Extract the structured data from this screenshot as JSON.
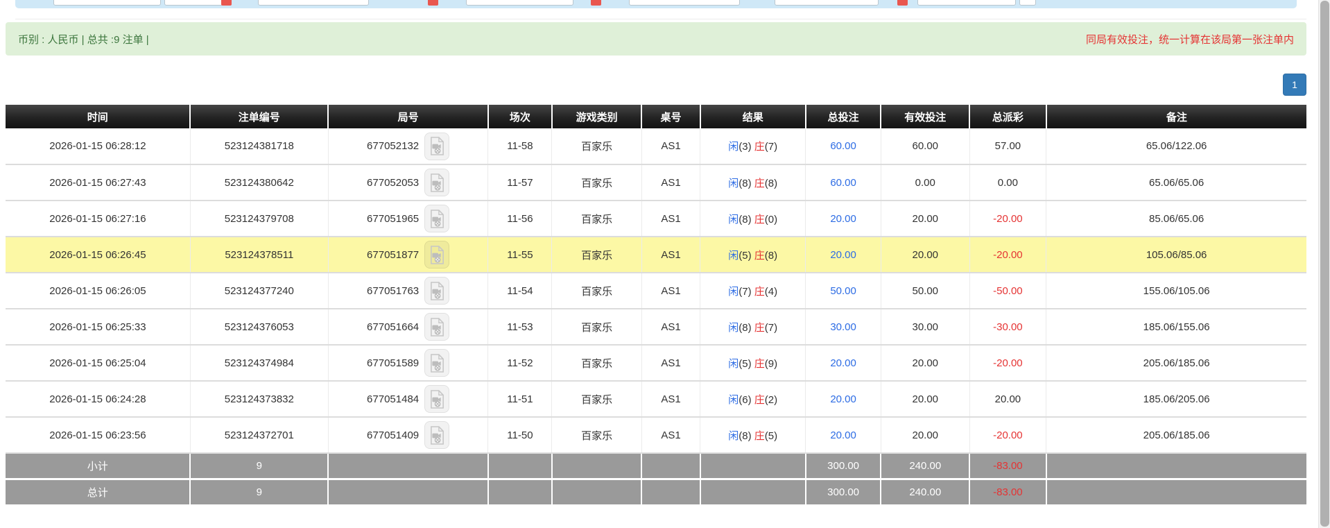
{
  "summary_bar": {
    "left_text": "币别 : 人民币 | 总共 :9 注单 |",
    "right_note": "同局有效投注，统一计算在该局第一张注单内"
  },
  "pagination": {
    "current_page": "1"
  },
  "table": {
    "columns": [
      "时间",
      "注单编号",
      "局号",
      "场次",
      "游戏类别",
      "桌号",
      "结果",
      "总投注",
      "有效投注",
      "总派彩",
      "备注"
    ],
    "rows": [
      {
        "time": "2026-01-15 06:28:12",
        "bet_id": "523124381718",
        "round_id": "677052132",
        "session": "11-58",
        "game_type": "百家乐",
        "table_no": "AS1",
        "result": {
          "player_label": "闲",
          "player_value": "(3)",
          "banker_label": "庄",
          "banker_value": "(7)"
        },
        "total_bet": "60.00",
        "valid_bet": "60.00",
        "payout": "57.00",
        "remark": "65.06/122.06",
        "highlight": false
      },
      {
        "time": "2026-01-15 06:27:43",
        "bet_id": "523124380642",
        "round_id": "677052053",
        "session": "11-57",
        "game_type": "百家乐",
        "table_no": "AS1",
        "result": {
          "player_label": "闲",
          "player_value": "(8)",
          "banker_label": "庄",
          "banker_value": "(8)"
        },
        "total_bet": "60.00",
        "valid_bet": "0.00",
        "payout": "0.00",
        "remark": "65.06/65.06",
        "highlight": false
      },
      {
        "time": "2026-01-15 06:27:16",
        "bet_id": "523124379708",
        "round_id": "677051965",
        "session": "11-56",
        "game_type": "百家乐",
        "table_no": "AS1",
        "result": {
          "player_label": "闲",
          "player_value": "(8)",
          "banker_label": "庄",
          "banker_value": "(0)"
        },
        "total_bet": "20.00",
        "valid_bet": "20.00",
        "payout": "-20.00",
        "remark": "85.06/65.06",
        "highlight": false
      },
      {
        "time": "2026-01-15 06:26:45",
        "bet_id": "523124378511",
        "round_id": "677051877",
        "session": "11-55",
        "game_type": "百家乐",
        "table_no": "AS1",
        "result": {
          "player_label": "闲",
          "player_value": "(5)",
          "banker_label": "庄",
          "banker_value": "(8)"
        },
        "total_bet": "20.00",
        "valid_bet": "20.00",
        "payout": "-20.00",
        "remark": "105.06/85.06",
        "highlight": true
      },
      {
        "time": "2026-01-15 06:26:05",
        "bet_id": "523124377240",
        "round_id": "677051763",
        "session": "11-54",
        "game_type": "百家乐",
        "table_no": "AS1",
        "result": {
          "player_label": "闲",
          "player_value": "(7)",
          "banker_label": "庄",
          "banker_value": "(4)"
        },
        "total_bet": "50.00",
        "valid_bet": "50.00",
        "payout": "-50.00",
        "remark": "155.06/105.06",
        "highlight": false
      },
      {
        "time": "2026-01-15 06:25:33",
        "bet_id": "523124376053",
        "round_id": "677051664",
        "session": "11-53",
        "game_type": "百家乐",
        "table_no": "AS1",
        "result": {
          "player_label": "闲",
          "player_value": "(8)",
          "banker_label": "庄",
          "banker_value": "(7)"
        },
        "total_bet": "30.00",
        "valid_bet": "30.00",
        "payout": "-30.00",
        "remark": "185.06/155.06",
        "highlight": false
      },
      {
        "time": "2026-01-15 06:25:04",
        "bet_id": "523124374984",
        "round_id": "677051589",
        "session": "11-52",
        "game_type": "百家乐",
        "table_no": "AS1",
        "result": {
          "player_label": "闲",
          "player_value": "(5)",
          "banker_label": "庄",
          "banker_value": "(9)"
        },
        "total_bet": "20.00",
        "valid_bet": "20.00",
        "payout": "-20.00",
        "remark": "205.06/185.06",
        "highlight": false
      },
      {
        "time": "2026-01-15 06:24:28",
        "bet_id": "523124373832",
        "round_id": "677051484",
        "session": "11-51",
        "game_type": "百家乐",
        "table_no": "AS1",
        "result": {
          "player_label": "闲",
          "player_value": "(6)",
          "banker_label": "庄",
          "banker_value": "(2)"
        },
        "total_bet": "20.00",
        "valid_bet": "20.00",
        "payout": "20.00",
        "remark": "185.06/205.06",
        "highlight": false
      },
      {
        "time": "2026-01-15 06:23:56",
        "bet_id": "523124372701",
        "round_id": "677051409",
        "session": "11-50",
        "game_type": "百家乐",
        "table_no": "AS1",
        "result": {
          "player_label": "闲",
          "player_value": "(8)",
          "banker_label": "庄",
          "banker_value": "(5)"
        },
        "total_bet": "20.00",
        "valid_bet": "20.00",
        "payout": "-20.00",
        "remark": "205.06/185.06",
        "highlight": false
      }
    ],
    "footer": [
      {
        "label": "小计",
        "count": "9",
        "total_bet": "300.00",
        "valid_bet": "240.00",
        "payout": "-83.00"
      },
      {
        "label": "总计",
        "count": "9",
        "total_bet": "300.00",
        "valid_bet": "240.00",
        "payout": "-83.00"
      }
    ],
    "icons": {
      "round_icon": "video-replay-icon"
    }
  },
  "colors": {
    "highlight_row": "#fcf8a5",
    "summary_bg": "#dff0d8",
    "summary_text": "#3c763d",
    "note_red": "#e53333",
    "value_blue": "#2d6ce4",
    "value_red": "#e53333",
    "header_bg": "#232323",
    "footer_bg": "#9a9a9a",
    "pager_blue": "#337ab7"
  }
}
